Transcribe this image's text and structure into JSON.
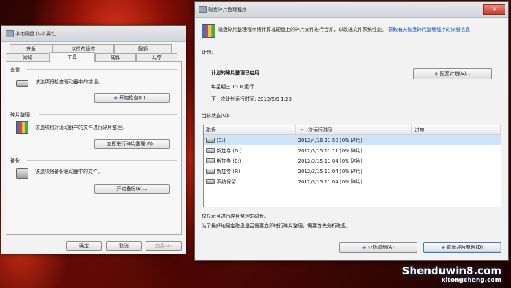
{
  "left_window": {
    "title": "本地磁盘 (C:) 属性",
    "tabs_row1": [
      "安全",
      "以前的版本",
      "配额"
    ],
    "tabs_row2": [
      "常规",
      "工具",
      "硬件",
      "共享"
    ],
    "active_tab": "工具",
    "check": {
      "title": "查错",
      "desc": "该选项将检查驱动器中的错误。",
      "button": "开始检查(C)..."
    },
    "defrag": {
      "title": "碎片整理",
      "desc": "该选项将对驱动器中的文件进行碎片整理。",
      "button": "立即进行碎片整理(D)..."
    },
    "backup": {
      "title": "备份",
      "desc": "该选项将备份驱动器中的文件。",
      "button": "开始备份(B)..."
    },
    "ok": "确定",
    "cancel": "取消",
    "apply": "应用(A)"
  },
  "right_window": {
    "title": "磁盘碎片整理程序",
    "close_label": "✕",
    "intro": "磁盘碎片整理程序将计算机硬盘上的碎片文件进行合并，以改进文件系统性能。",
    "link": "获取有关磁盘碎片整理程序的详细信息",
    "schedule_label": "计划:",
    "schedule_status": "计划的碎片整理已启用",
    "schedule_when": "每星期三  1:00 运行",
    "next_run": "下一次计划运行时间: 2012/5/9 1:23",
    "configure_button": "配置计划(S)...",
    "current_status": "当前状态(U):",
    "columns": [
      "磁盘",
      "上一次运行时间",
      "进度"
    ],
    "volumes": [
      {
        "name": "(C:)",
        "last_run": "2012/4/16 21:50 (0% 碎片)",
        "progress": ""
      },
      {
        "name": "新加卷 (D:)",
        "last_run": "2012/3/15 11:11 (0% 碎片)",
        "progress": ""
      },
      {
        "name": "新加卷 (E:)",
        "last_run": "2012/3/15 11:04 (0% 碎片)",
        "progress": ""
      },
      {
        "name": "新加卷 (F:)",
        "last_run": "2012/3/15 11:04 (0% 碎片)",
        "progress": ""
      },
      {
        "name": "系统保留",
        "last_run": "2012/3/15 11:04 (0% 碎片)",
        "progress": ""
      }
    ],
    "note1": "仅显示可进行碎片整理的磁盘。",
    "note2": "为了最好地确定磁盘是否需要立即进行碎片整理，需要首先分析磁盘。",
    "analyze_button": "分析磁盘(A)",
    "defrag_button": "磁盘碎片整理(D)"
  },
  "watermark": {
    "main": "Shenduwin8.com",
    "sub": "xitongcheng.com"
  }
}
